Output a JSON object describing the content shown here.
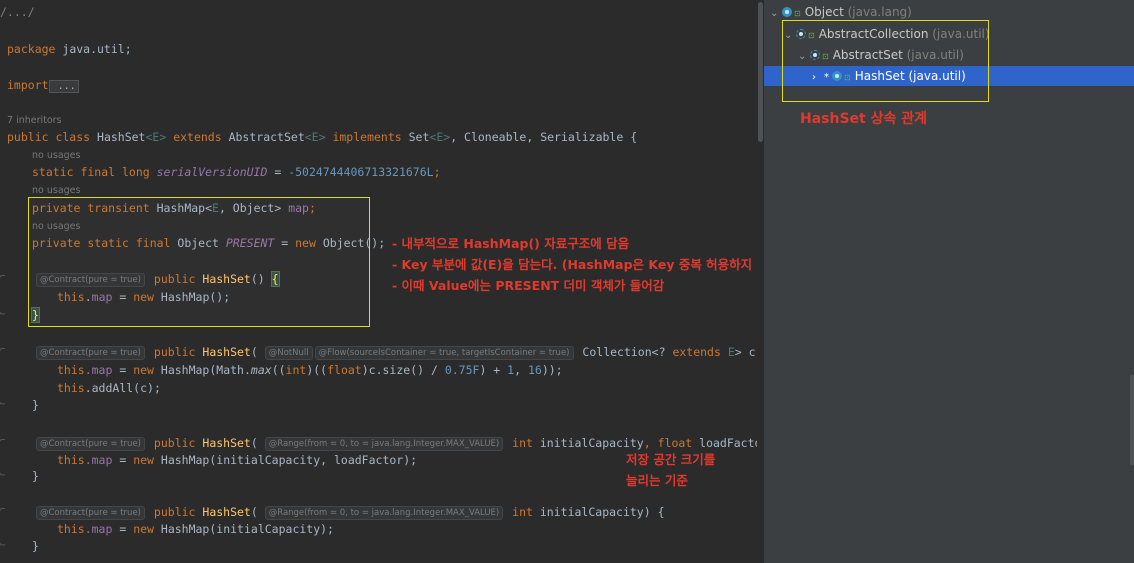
{
  "editor": {
    "l_path": "/.../",
    "l_package_kw": "package",
    "l_package_name": " java.util;",
    "l_import_kw": "import",
    "l_import_rest": " ...",
    "l_inheritors": "7 inheritors",
    "class_line": {
      "k1": "public class ",
      "name": "HashSet",
      "g1": "<E>",
      "k2": " extends ",
      "sup": "AbstractSet",
      "g2": "<E>",
      "k3": " implements ",
      "ifaces": "Set",
      "g3": "<E>",
      "rest": ", Cloneable, Serializable {"
    },
    "no_usages": "no usages",
    "serial": {
      "mods": "static final long ",
      "name": "serialVersionUID",
      "eq": " = ",
      "val": "-5024744406713321676L",
      "end": ";"
    },
    "map_field": {
      "mods": "private transient ",
      "type": "HashMap<",
      "tp": "E",
      "rest": ", Object> ",
      "name": "map",
      "end": ";"
    },
    "present_field": {
      "mods": "private static final ",
      "type": "Object ",
      "name": "PRESENT",
      "eq": " = ",
      "kw": "new",
      "rest": " Object();"
    },
    "contract": "@Contract(pure = true)",
    "ctor1": {
      "kw": " public ",
      "name": "HashSet",
      "rest": "() ",
      "brace": "{"
    },
    "ctor1_body": {
      "this": "this",
      "dot": ".",
      "fld": "map",
      "eq": " = ",
      "kw": "new",
      "rest": " HashMap();"
    },
    "close_brace": "}",
    "ctor2": {
      "kw": " public ",
      "name": "HashSet",
      "paren": "( ",
      "ann1": "@NotNull",
      "ann2": "@Flow(sourceIsContainer = true, targetIsContainer = true)",
      "type": " Collection<? ",
      "ext": "extends",
      "tp": " E",
      "rest": "> c) {"
    },
    "ctor2_body1": {
      "this": "this",
      "fld": ".map",
      "eq": " = ",
      "kw": "new",
      "a": " HashMap(Math.",
      "max": "max",
      "b": "((",
      "int": "int",
      "c": ")((",
      "float": "float",
      "d": ")c.size() / ",
      "n1": "0.75F",
      "e": ") + ",
      "n2": "1",
      "f": ", ",
      "n3": "16",
      "g": "));"
    },
    "ctor2_body2": {
      "this": "this",
      "rest": ".addAll(c);"
    },
    "ctor3": {
      "kw": " public ",
      "name": "HashSet",
      "paren": "( ",
      "ann": "@Range(from = 0, to = java.lang.Integer.MAX_VALUE)",
      "t1": " int",
      "p1": " initialCapacity",
      "comma": ", ",
      "t2": "float",
      "p2": " loadFactor",
      "end": ") {"
    },
    "ctor3_body": {
      "this": "this",
      "fld": ".map",
      "eq": " = ",
      "kw": "new",
      "rest": " HashMap(initialCapacity, loadFactor);"
    },
    "ctor4": {
      "kw": " public ",
      "name": "HashSet",
      "paren": "( ",
      "ann": "@Range(from = 0, to = java.lang.Integer.MAX_VALUE)",
      "t1": " int",
      "p1": " initialCapacity",
      "end": ") {"
    },
    "ctor4_body": {
      "this": "this",
      "fld": ".map",
      "eq": " = ",
      "kw": "new",
      "rest": " HashMap(initialCapacity);"
    }
  },
  "notes": {
    "n1": "- 내부적으로 HashMap() 자료구조에 담음",
    "n2": "- Key 부분에 값(E)을 담는다. (HashMap은 Key 중복 허용하지 않음)",
    "n3": "- 이때 Value에는 PRESENT 더미 객체가 들어감",
    "n4a": "저장 공간 크기를",
    "n4b": "늘리는 기준",
    "hier_caption": "HashSet 상속 관계"
  },
  "hierarchy": {
    "rows": [
      {
        "name": "Object",
        "pkg": " (java.lang)"
      },
      {
        "name": "AbstractCollection",
        "pkg": " (java.util)"
      },
      {
        "name": "AbstractSet",
        "pkg": " (java.util)"
      },
      {
        "name": "HashSet",
        "pkg": " (java.util)"
      }
    ]
  },
  "colors": {
    "keyword": "#cc7832",
    "string_num": "#6897bb",
    "field": "#9876aa",
    "method": "#ffc66d",
    "selection": "#2f65ca",
    "annotation_note": "#e03a2e",
    "highlight_box": "#e0dc1e"
  }
}
